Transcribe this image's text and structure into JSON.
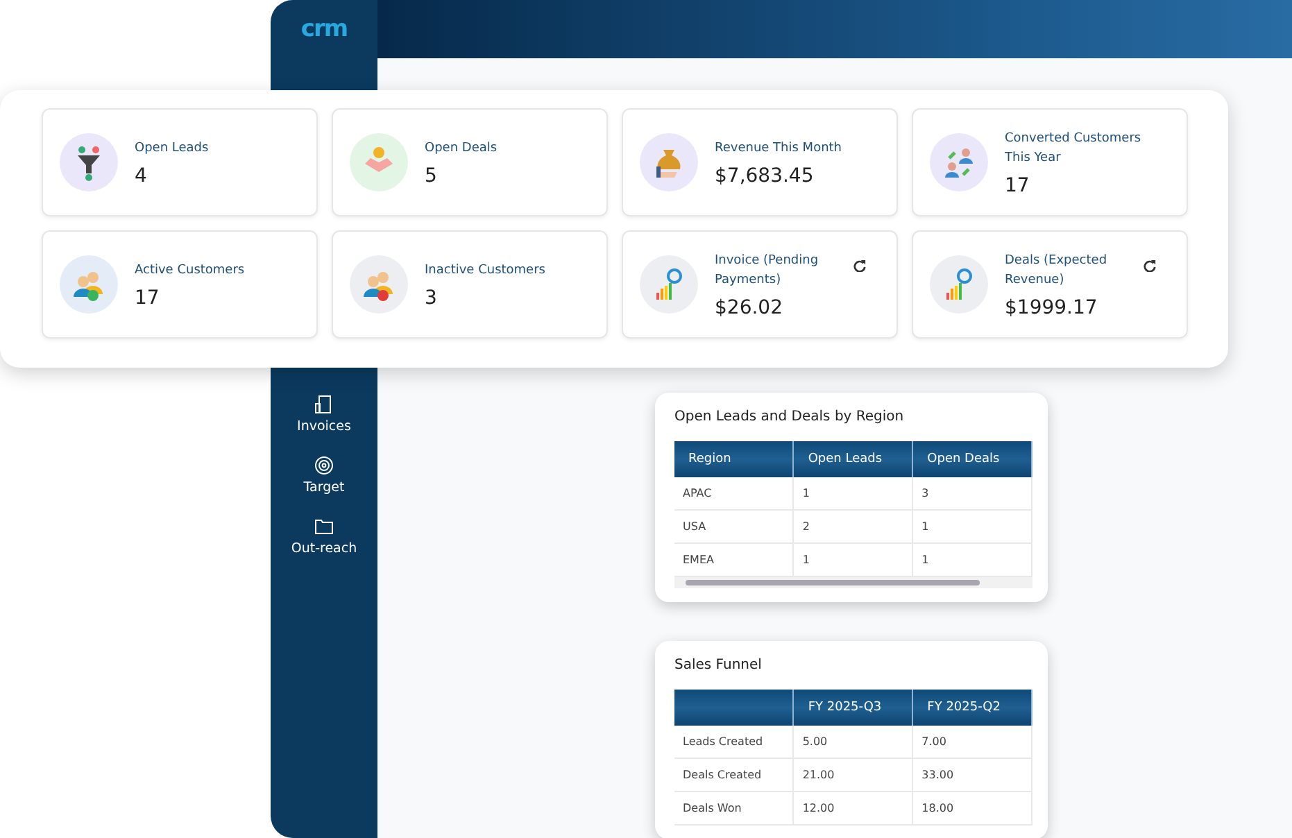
{
  "app": {
    "logo": "crm",
    "sidebar": {
      "items": [
        {
          "label": "Invoices"
        },
        {
          "label": "Target"
        },
        {
          "label": "Out-reach"
        }
      ]
    }
  },
  "kpi_cards": [
    {
      "label": "Open Leads",
      "value": "4",
      "refresh": false
    },
    {
      "label": "Open Deals",
      "value": "5",
      "refresh": false
    },
    {
      "label": "Revenue This Month",
      "value": "$7,683.45",
      "refresh": false
    },
    {
      "label": "Converted Customers This Year",
      "value": "17",
      "refresh": false
    },
    {
      "label": "Active Customers",
      "value": "17",
      "refresh": false
    },
    {
      "label": "Inactive Customers",
      "value": "3",
      "refresh": false
    },
    {
      "label": "Invoice (Pending Payments)",
      "value": "$26.02",
      "refresh": true
    },
    {
      "label": "Deals (Expected Revenue)",
      "value": "$1999.17",
      "refresh": true
    }
  ],
  "region_table": {
    "title": "Open Leads and Deals by Region",
    "columns": [
      "Region",
      "Open Leads",
      "Open Deals"
    ],
    "rows": [
      [
        "APAC",
        "1",
        "3"
      ],
      [
        "USA",
        "2",
        "1"
      ],
      [
        "EMEA",
        "1",
        "1"
      ]
    ]
  },
  "sales_funnel": {
    "title": "Sales Funnel",
    "columns": [
      "",
      "FY 2025-Q3",
      "FY 2025-Q2"
    ],
    "rows": [
      [
        "Leads Created",
        "5.00",
        "7.00"
      ],
      [
        "Deals Created",
        "21.00",
        "33.00"
      ],
      [
        "Deals Won",
        "12.00",
        "18.00"
      ]
    ]
  }
}
